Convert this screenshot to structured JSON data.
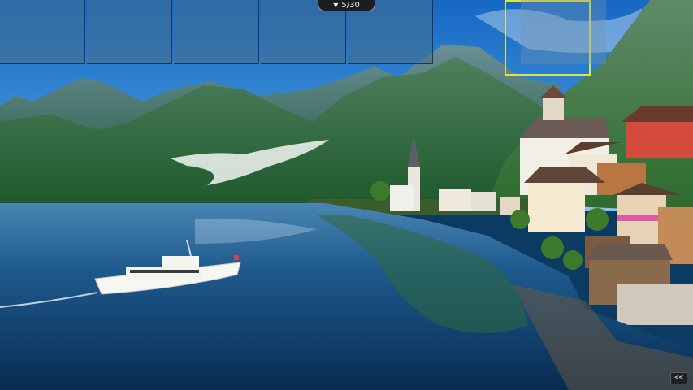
{
  "viewer": {
    "counter": "5/30",
    "counter_icon": "chevron-down-icon",
    "collapse_label": "<<",
    "thumbnails": [
      "",
      "",
      "",
      "",
      "",
      "",
      "",
      ""
    ],
    "active_thumbnail_index": 6,
    "highlight_color": "#d8e44a"
  },
  "photo": {
    "subject": "lakeside-village-with-mountains",
    "colors": {
      "sky": "#1c6fc4",
      "water": "#0f3e6e",
      "mountain": "#2f6b3a",
      "house_roof": "#6c3a2a"
    }
  }
}
